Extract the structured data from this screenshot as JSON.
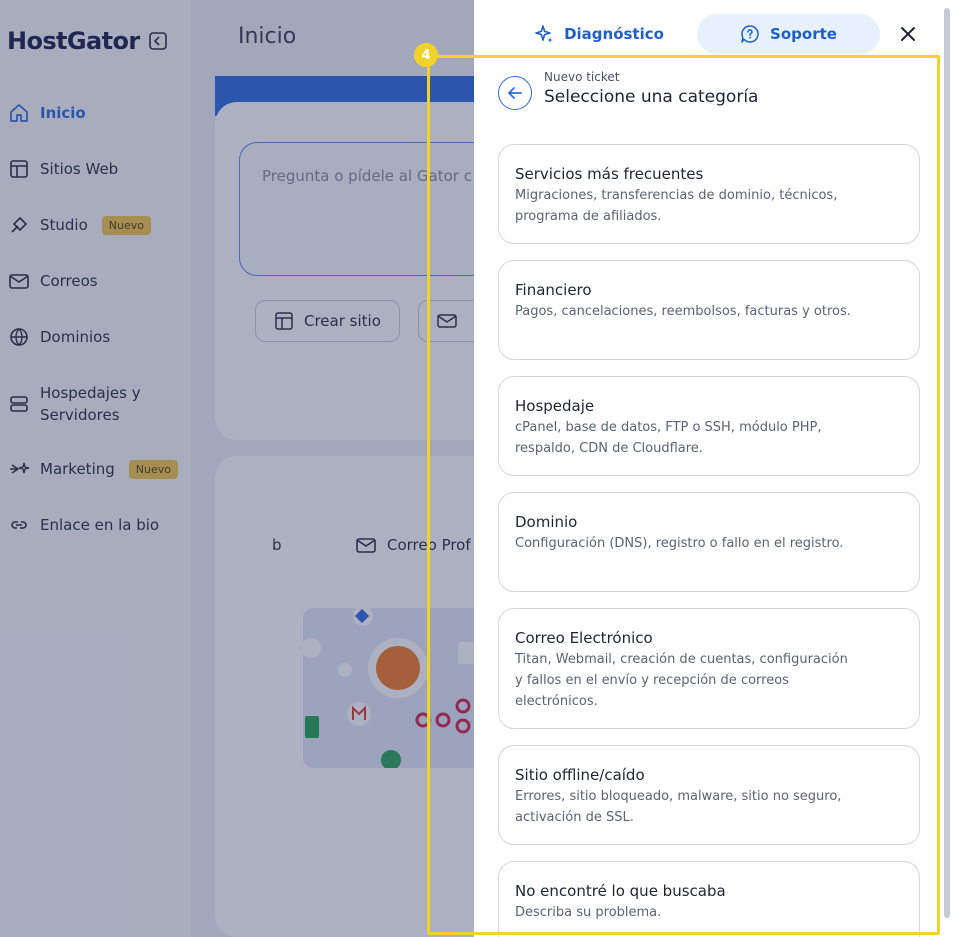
{
  "sidebar": {
    "logo": "HostGator",
    "items": [
      {
        "label": "Inicio",
        "badge": ""
      },
      {
        "label": "Sitios Web",
        "badge": ""
      },
      {
        "label": "Studio",
        "badge": "Nuevo"
      },
      {
        "label": "Correos",
        "badge": ""
      },
      {
        "label": "Dominios",
        "badge": ""
      },
      {
        "label": "Hospedajes y Servidores",
        "label_line1": "Hospedajes y",
        "label_line2": "Servidores",
        "badge": ""
      },
      {
        "label": "Marketing",
        "badge": "Nuevo"
      },
      {
        "label": "Enlace en la bio",
        "badge": ""
      }
    ]
  },
  "main": {
    "title": "Inicio",
    "prompt_placeholder": "Pregunta o pídele al Gator c",
    "create_site": "Crear sitio",
    "letter_b": "b",
    "mail_label": "Correo Prof"
  },
  "drawer": {
    "tabs": [
      {
        "label": "Diagnóstico",
        "icon": "sparkle-icon",
        "active": false
      },
      {
        "label": "Soporte",
        "icon": "chat-question-icon",
        "active": true
      }
    ],
    "header": {
      "subtitle": "Nuevo ticket",
      "title": "Seleccione una categoría"
    },
    "categories": [
      {
        "title": "Servicios más frecuentes",
        "description": "Migraciones, transferencias de dominio, técnicos, programa de afiliados."
      },
      {
        "title": "Financiero",
        "description": "Pagos, cancelaciones, reembolsos, facturas y otros."
      },
      {
        "title": "Hospedaje",
        "description": "cPanel, base de datos, FTP o SSH, módulo PHP, respaldo, CDN de Cloudflare."
      },
      {
        "title": "Dominio",
        "description": "Configuración (DNS), registro o fallo en el registro."
      },
      {
        "title": "Correo Electrónico",
        "description": "Titan, Webmail, creación de cuentas, configuración y fallos en el envío y recepción de correos electrónicos."
      },
      {
        "title": "Sitio offline/caído",
        "description": "Errores, sitio bloqueado, malware, sitio no seguro, activación de SSL."
      },
      {
        "title": "No encontré lo que buscaba",
        "description": "Describa su problema."
      }
    ]
  },
  "highlight": {
    "number": "4"
  },
  "colors": {
    "accent": "#2d6cdf",
    "highlight": "#f0d22a",
    "badge": "#f2c94c"
  }
}
